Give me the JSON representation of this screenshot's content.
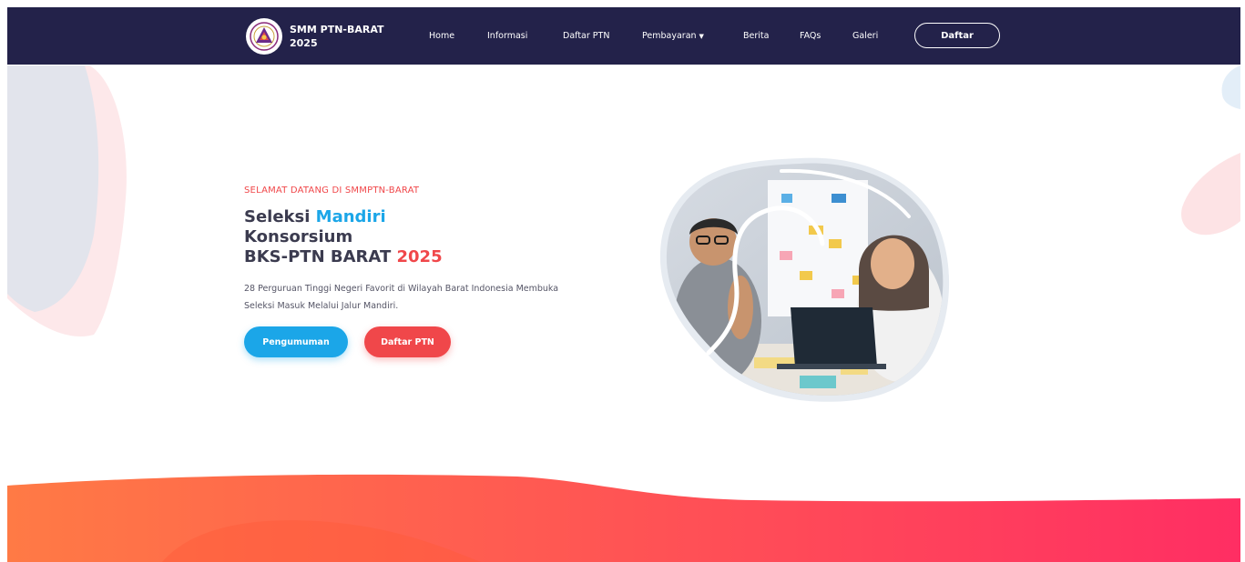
{
  "navbar": {
    "brand_line1": "SMM PTN-BARAT",
    "brand_line2": "2025",
    "logo_icon": "emblem-logo-icon",
    "links": [
      "Home",
      "Informasi",
      "Daftar PTN",
      "Pembayaran",
      "Berita",
      "FAQs",
      "Galeri"
    ],
    "dropdown_icon": "caret-down-icon",
    "register_label": "Daftar"
  },
  "hero": {
    "welcome": "SELAMAT DATANG DI SMMPTN-BARAT",
    "headline": {
      "part1": "Seleksi ",
      "mandiri": "Mandiri",
      "line2": "Konsorsium",
      "line3_prefix": "BKS-PTN BARAT ",
      "year": "2025"
    },
    "description": "28 Perguruan Tinggi Negeri Favorit di Wilayah Barat Indonesia Membuka Seleksi Masuk Melalui Jalur Mandiri.",
    "btn_announcement": "Pengumuman",
    "btn_ptn_list": "Daftar PTN",
    "photo": "students-collaborating-photo"
  },
  "colors": {
    "navbar_bg": "#23224a",
    "accent_blue": "#1ba6e8",
    "accent_red": "#f0474a",
    "wave_gradient": [
      "#ff7a45",
      "#ff2e63"
    ]
  }
}
